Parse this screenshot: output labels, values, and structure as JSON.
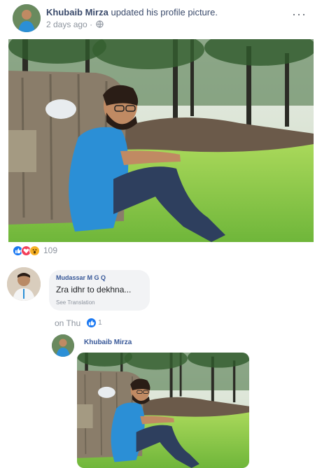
{
  "post": {
    "author": "Khubaib Mirza",
    "action": "updated his profile picture.",
    "time": "2 days ago",
    "separator": "·",
    "privacy_icon": "globe-icon",
    "more_label": "···"
  },
  "reactions": {
    "icons": [
      "like-icon",
      "love-icon",
      "wow-icon"
    ],
    "count": "109"
  },
  "comment": {
    "author": "Mudassar M G Q",
    "text": "Zra idhr to dekhna...",
    "translate_label": "See Translation",
    "time": "on Thu",
    "like_count": "1"
  },
  "reply": {
    "author": "Khubaib Mirza"
  },
  "colors": {
    "link": "#385898",
    "muted": "#8d949e",
    "like_blue": "#1877f2",
    "love_red": "#f33e58",
    "wow_yellow": "#f7b125",
    "shirt_blue": "#2b8fd6",
    "grass": "#8fcf4a"
  }
}
